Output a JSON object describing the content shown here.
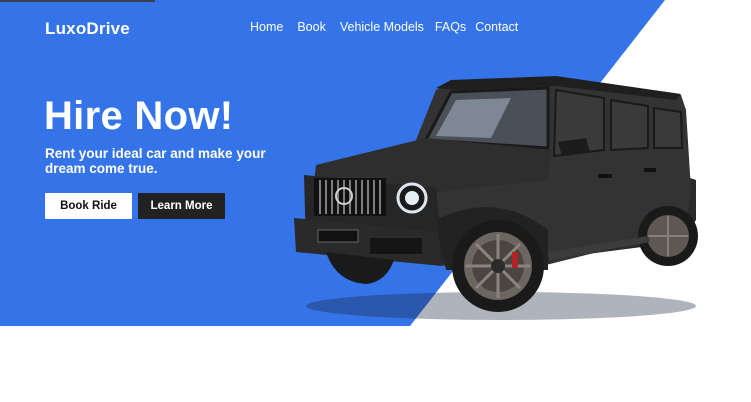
{
  "brand": {
    "name": "LuxoDrive"
  },
  "nav": {
    "items": [
      {
        "label": "Home"
      },
      {
        "label": "Book"
      },
      {
        "label": "Vehicle Models"
      },
      {
        "label": "FAQs"
      },
      {
        "label": "Contact"
      }
    ]
  },
  "hero": {
    "headline": "Hire Now!",
    "subheadline": "Rent your ideal car and make your dream come true.",
    "primary_button": "Book Ride",
    "secondary_button": "Learn More",
    "image": "black-luxury-suv"
  },
  "colors": {
    "accent": "#3574e8",
    "dark_button": "#222222",
    "background": "#ffffff"
  }
}
